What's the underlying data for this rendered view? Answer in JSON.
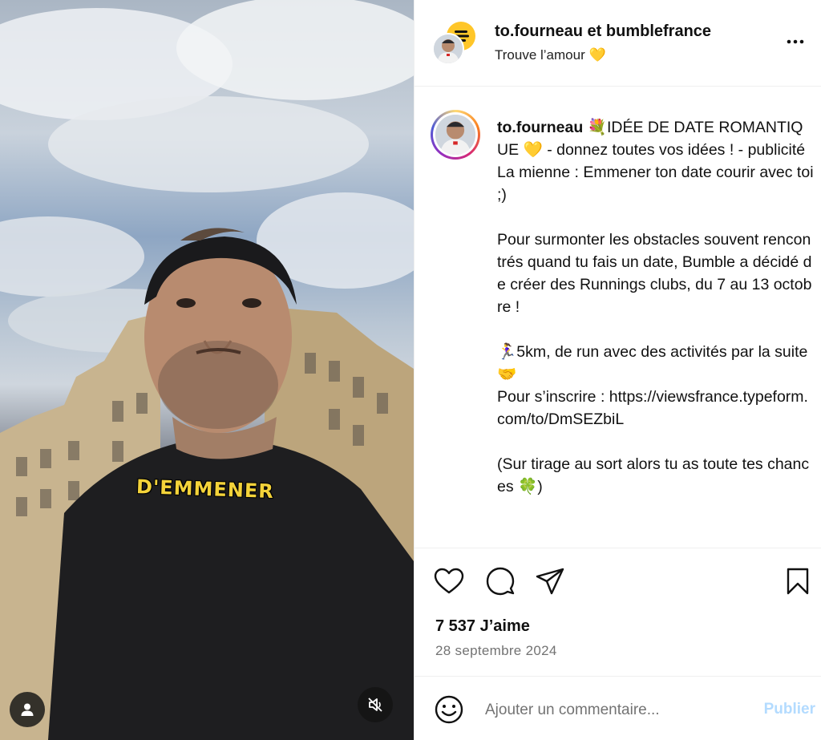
{
  "media": {
    "caption_overlay": "D'EMMENER",
    "user_tag_icon": "person-icon",
    "mute_icon": "speaker-muted-icon"
  },
  "header": {
    "usernames": "to.fourneau et bumblefrance",
    "subtitle": "Trouve l’amour 💛",
    "more_icon": "more-horizontal-icon"
  },
  "caption": {
    "author": "to.fourneau",
    "text": " 💐IDÉE DE DATE ROMANTIQUE 💛 - donnez toutes vos idées ! - publicité\nLa mienne : Emmener ton date courir avec toi ;)\n\nPour surmonter les obstacles souvent rencontrés quand tu fais un date, Bumble a décidé de créer des Runnings clubs, du 7 au 13 octobre !\n\n🏃‍♀️5km, de run avec des activités par la suite 🤝\nPour s’inscrire : https://viewsfrance.typeform.com/to/DmSEZbiL\n\n(Sur tirage au sort alors tu as toute tes chances 🍀)"
  },
  "actions": {
    "icons": [
      "heart-icon",
      "comment-icon",
      "share-icon",
      "bookmark-icon"
    ],
    "likes": "7 537 J’aime",
    "date": "28 septembre 2024"
  },
  "comment": {
    "placeholder": "Ajouter un commentaire...",
    "post_label": "Publier",
    "emoji_icon": "emoji-icon"
  },
  "colors": {
    "caption_overlay": "#f4d33a",
    "bumble_yellow": "#ffc629",
    "post_disabled": "#b3dbff",
    "muted_text": "#737373"
  }
}
